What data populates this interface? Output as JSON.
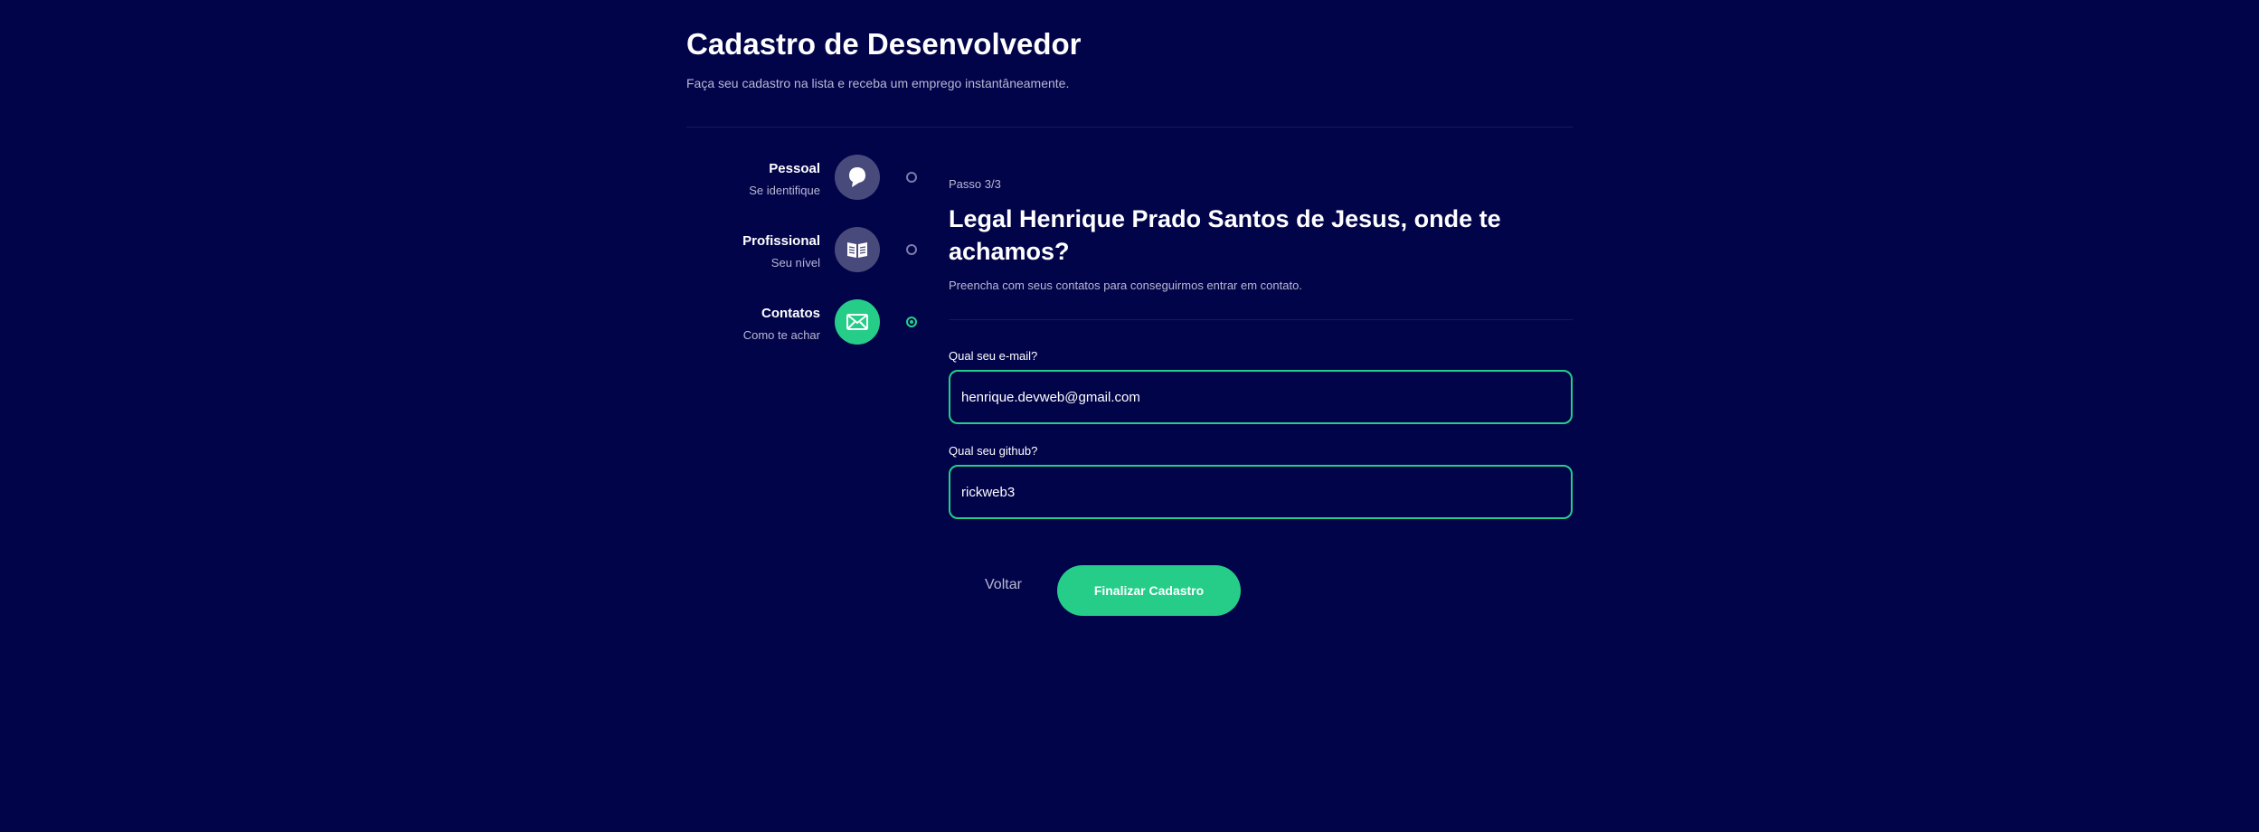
{
  "header": {
    "title": "Cadastro de Desenvolvedor",
    "subtitle": "Faça seu cadastro na lista e receba um emprego instantâneamente."
  },
  "steps": [
    {
      "label": "Pessoal",
      "description": "Se identifique",
      "icon": "profile-icon",
      "active": false
    },
    {
      "label": "Profissional",
      "description": "Seu nível",
      "icon": "book-icon",
      "active": false
    },
    {
      "label": "Contatos",
      "description": "Como te achar",
      "icon": "mail-icon",
      "active": true
    }
  ],
  "form": {
    "step_counter": "Passo 3/3",
    "title": "Legal Henrique Prado Santos de Jesus, onde te achamos?",
    "subtitle": "Preencha com seus contatos para conseguirmos entrar em contato.",
    "email": {
      "label": "Qual seu e-mail?",
      "value": "henrique.devweb@gmail.com"
    },
    "github": {
      "label": "Qual seu github?",
      "value": "rickweb3"
    },
    "back_label": "Voltar",
    "finish_label": "Finalizar Cadastro"
  },
  "colors": {
    "background": "#02044a",
    "accent": "#25cd89",
    "inactive_icon_bg": "#494a7c",
    "muted_text": "#b8b8d4"
  }
}
